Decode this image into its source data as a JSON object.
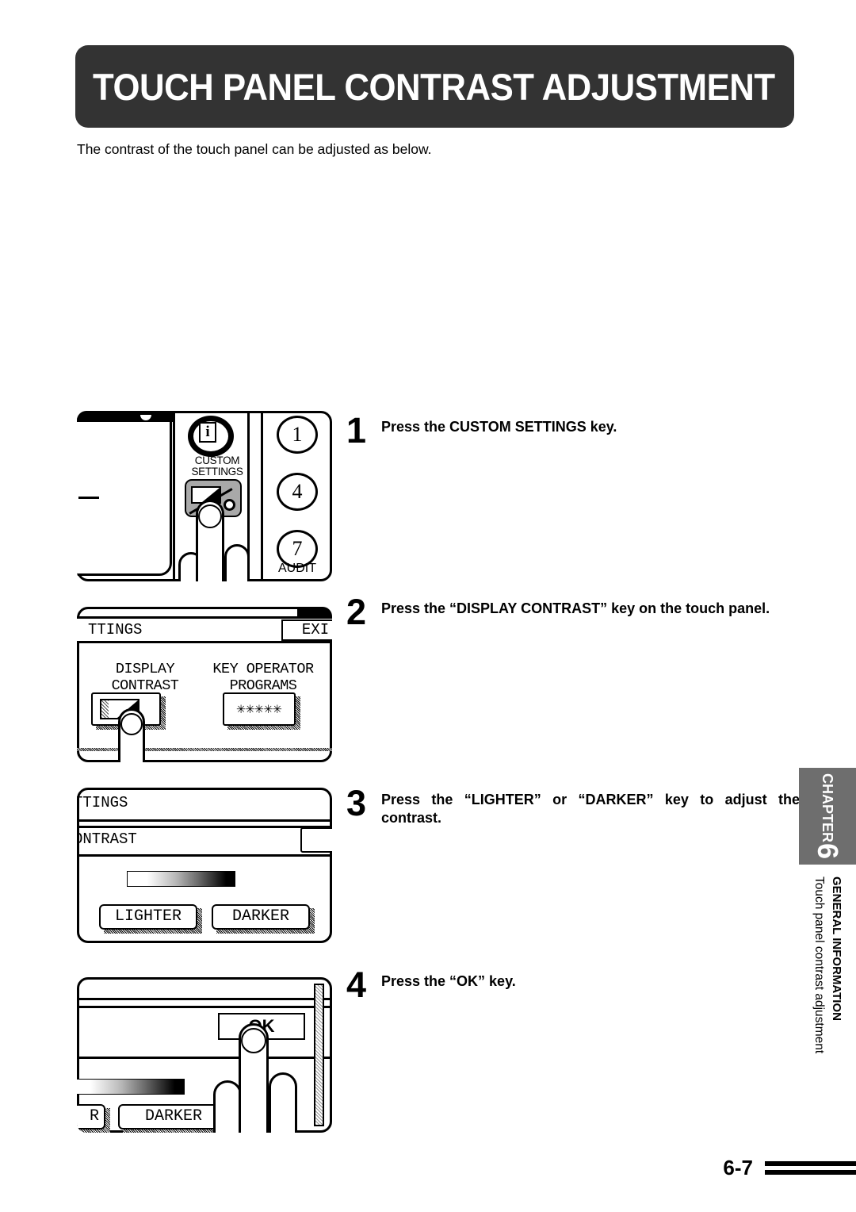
{
  "header": {
    "title": "TOUCH PANEL CONTRAST ADJUSTMENT"
  },
  "intro": "The contrast of the touch panel can be adjusted as below.",
  "steps": [
    {
      "number": "1",
      "text": "Press the CUSTOM SETTINGS key."
    },
    {
      "number": "2",
      "text": "Press the “DISPLAY CONTRAST” key on the touch panel."
    },
    {
      "number": "3",
      "text": "Press the “LIGHTER” or “DARKER” key to adjust the contrast."
    },
    {
      "number": "4",
      "text": "Press the “OK” key."
    }
  ],
  "panel1": {
    "info_icon_letter": "i",
    "key_label_line1": "CUSTOM",
    "key_label_line2": "SETTINGS",
    "numeric_keys": [
      "1",
      "4",
      "7"
    ],
    "audit_label": "AUDIT"
  },
  "panel2": {
    "title": "TTINGS",
    "exit_label": "EXI",
    "display_contrast_line1": "DISPLAY",
    "display_contrast_line2": "CONTRAST",
    "key_operator_line1": "KEY OPERATOR",
    "key_operator_line2": "PROGRAMS",
    "key_operator_value": "✳✳✳✳✳"
  },
  "panel3": {
    "title": "TTINGS",
    "subtitle": "ONTRAST",
    "lighter_label": "LIGHTER",
    "darker_label": "DARKER"
  },
  "panel4": {
    "ok_label": "OK",
    "lighter_label": "R",
    "darker_label": "DARKER"
  },
  "sidebar": {
    "chapter_word": "CHAPTER",
    "chapter_number": "6",
    "section_bold": "GENERAL INFORMATION",
    "section_regular": "Touch panel contrast adjustment",
    "tab_color": "#6e6e6e"
  },
  "footer": {
    "page_number": "6-7"
  }
}
